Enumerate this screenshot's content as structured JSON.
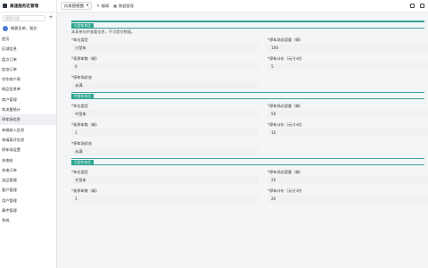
{
  "sidebar": {
    "title": "高速服务区管理",
    "search_placeholder": "搜索页面",
    "plus": "+",
    "user": "情客员单，我总",
    "items": [
      {
        "label": "首页",
        "active": false
      },
      {
        "label": "区域信息",
        "active": false
      },
      {
        "label": "盘点订单",
        "active": false
      },
      {
        "label": "加油订单",
        "active": false
      },
      {
        "label": "合作商户表",
        "active": false
      },
      {
        "label": "商品信息单",
        "active": false
      },
      {
        "label": "商户管理",
        "active": false
      },
      {
        "label": "车流量统计",
        "active": false
      },
      {
        "label": "停车场信息",
        "active": true
      },
      {
        "label": "车辆驶入信息",
        "active": false
      },
      {
        "label": "车辆离开信息",
        "active": false
      },
      {
        "label": "停车场设置",
        "active": false
      },
      {
        "label": "充电桩",
        "active": false
      },
      {
        "label": "充电订单",
        "active": false
      },
      {
        "label": "油品管理",
        "active": false
      },
      {
        "label": "客户管理",
        "active": false
      },
      {
        "label": "用户管理",
        "active": false
      },
      {
        "label": "事件管理",
        "active": false
      },
      {
        "label": "系统",
        "active": false
      }
    ]
  },
  "toolbar": {
    "view_select": "仪表盘视图",
    "edit_label": "编辑",
    "data_label": "数据管理"
  },
  "sections": [
    {
      "badge": "小型车车位",
      "note": "本表单仅供查看信息，不可提交数据。",
      "fields": [
        {
          "label": "*车位类型",
          "value": "小型车"
        },
        {
          "label": "*停车场总容量（辆）",
          "value": "100"
        },
        {
          "label": "*现停车数（辆）",
          "value": "0"
        },
        {
          "label": "*停车计价（元/小时）",
          "value": "5"
        },
        {
          "label": "*停车场状态",
          "value": "未满"
        }
      ]
    },
    {
      "badge": "中型车车位",
      "note": "",
      "fields": [
        {
          "label": "*车位类型",
          "value": "中型车"
        },
        {
          "label": "*停车场总容量（辆）",
          "value": "50"
        },
        {
          "label": "*现停车数（辆）",
          "value": "1"
        },
        {
          "label": "*停车计价（元/小时）",
          "value": "10"
        },
        {
          "label": "*停车场状态",
          "value": "未满"
        }
      ]
    },
    {
      "badge": "大型车车位",
      "note": "",
      "fields": [
        {
          "label": "*车位类型",
          "value": "大型车"
        },
        {
          "label": "*停车场总容量（辆）",
          "value": "20"
        },
        {
          "label": "*现停车数（辆）",
          "value": "1"
        },
        {
          "label": "*停车计价（元/小时）",
          "value": "20"
        }
      ]
    }
  ]
}
